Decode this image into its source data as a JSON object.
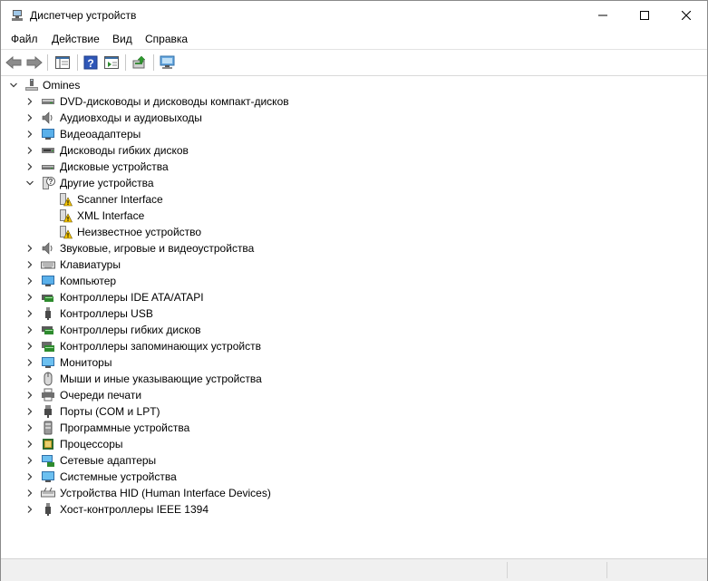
{
  "window": {
    "title": "Диспетчер устройств"
  },
  "menu": [
    "Файл",
    "Действие",
    "Вид",
    "Справка"
  ],
  "tree": {
    "root": "Omines",
    "categories": [
      {
        "label": "DVD-дисководы и дисководы компакт-дисков",
        "icon": "dvd-drive-icon"
      },
      {
        "label": "Аудиовходы и аудиовыходы",
        "icon": "speaker-icon"
      },
      {
        "label": "Видеоадаптеры",
        "icon": "display-adapter-icon"
      },
      {
        "label": "Дисководы гибких дисков",
        "icon": "floppy-drive-icon"
      },
      {
        "label": "Дисковые устройства",
        "icon": "disk-drive-icon"
      },
      {
        "label": "Другие устройства",
        "icon": "unknown-device-icon",
        "expanded": true,
        "children": [
          "Scanner Interface",
          "XML Interface",
          "Неизвестное устройство"
        ]
      },
      {
        "label": "Звуковые, игровые и видеоустройства",
        "icon": "speaker-icon"
      },
      {
        "label": "Клавиатуры",
        "icon": "keyboard-icon"
      },
      {
        "label": "Компьютер",
        "icon": "computer-icon"
      },
      {
        "label": "Контроллеры IDE ATA/ATAPI",
        "icon": "ide-controller-icon"
      },
      {
        "label": "Контроллеры USB",
        "icon": "usb-icon"
      },
      {
        "label": "Контроллеры гибких дисков",
        "icon": "floppy-controller-icon"
      },
      {
        "label": "Контроллеры запоминающих устройств",
        "icon": "storage-controller-icon"
      },
      {
        "label": "Мониторы",
        "icon": "monitor-icon"
      },
      {
        "label": "Мыши и иные указывающие устройства",
        "icon": "mouse-icon"
      },
      {
        "label": "Очереди печати",
        "icon": "printer-icon"
      },
      {
        "label": "Порты (COM и LPT)",
        "icon": "port-icon"
      },
      {
        "label": "Программные устройства",
        "icon": "software-device-icon"
      },
      {
        "label": "Процессоры",
        "icon": "processor-icon"
      },
      {
        "label": "Сетевые адаптеры",
        "icon": "network-adapter-icon"
      },
      {
        "label": "Системные устройства",
        "icon": "system-device-icon"
      },
      {
        "label": "Устройства HID (Human Interface Devices)",
        "icon": "hid-icon"
      },
      {
        "label": "Хост-контроллеры IEEE 1394",
        "icon": "ieee1394-icon"
      }
    ]
  }
}
